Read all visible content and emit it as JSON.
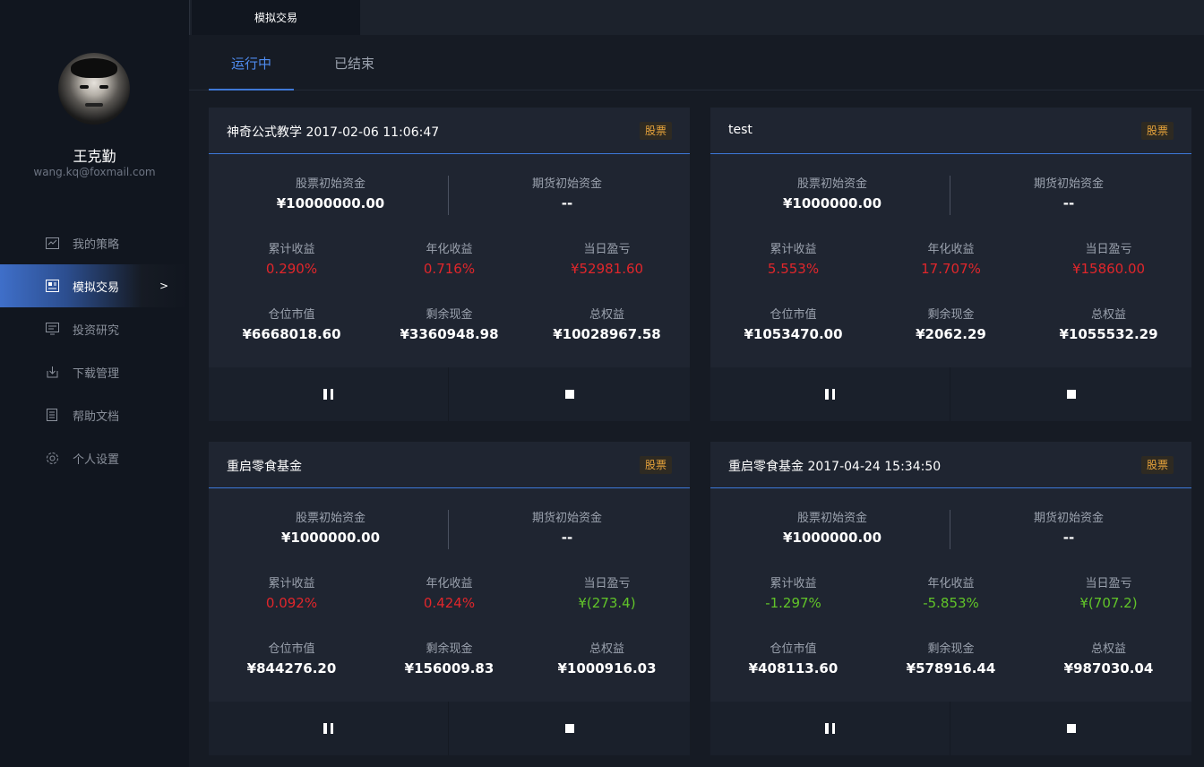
{
  "user": {
    "name": "王克勤",
    "email": "wang.kq@foxmail.com"
  },
  "sidebar": {
    "items": [
      {
        "label": "我的策略",
        "icon": "strategy-icon"
      },
      {
        "label": "模拟交易",
        "icon": "simulated-trading-icon",
        "active": true,
        "chevron": ">"
      },
      {
        "label": "投资研究",
        "icon": "research-icon"
      },
      {
        "label": "下载管理",
        "icon": "download-icon"
      },
      {
        "label": "帮助文档",
        "icon": "document-icon"
      },
      {
        "label": "个人设置",
        "icon": "gear-icon"
      }
    ]
  },
  "topbar": {
    "tab_label": "模拟交易"
  },
  "subtabs": {
    "running": "运行中",
    "ended": "已结束"
  },
  "labels": {
    "stock_initial": "股票初始资金",
    "futures_initial": "期货初始资金",
    "cumulative_return": "累计收益",
    "annualized_return": "年化收益",
    "daily_pnl": "当日盈亏",
    "position_value": "仓位市值",
    "remaining_cash": "剩余现金",
    "total_equity": "总权益"
  },
  "cards": [
    {
      "title": "神奇公式教学 2017-02-06 11:06:47",
      "badge": "股票",
      "stock_initial": "¥10000000.00",
      "futures_initial": "--",
      "cumulative_return": "0.290%",
      "annualized_return": "0.716%",
      "daily_pnl": "¥52981.60",
      "position_value": "¥6668018.60",
      "remaining_cash": "¥3360948.98",
      "total_equity": "¥10028967.58",
      "colors": {
        "cumulative_return": "#e0262b",
        "annualized_return": "#e0262b",
        "daily_pnl": "#e0262b"
      }
    },
    {
      "title": "test",
      "badge": "股票",
      "stock_initial": "¥1000000.00",
      "futures_initial": "--",
      "cumulative_return": "5.553%",
      "annualized_return": "17.707%",
      "daily_pnl": "¥15860.00",
      "position_value": "¥1053470.00",
      "remaining_cash": "¥2062.29",
      "total_equity": "¥1055532.29",
      "colors": {
        "cumulative_return": "#e0262b",
        "annualized_return": "#e0262b",
        "daily_pnl": "#e0262b"
      }
    },
    {
      "title": "重启零食基金",
      "badge": "股票",
      "stock_initial": "¥1000000.00",
      "futures_initial": "--",
      "cumulative_return": "0.092%",
      "annualized_return": "0.424%",
      "daily_pnl": "¥(273.4)",
      "position_value": "¥844276.20",
      "remaining_cash": "¥156009.83",
      "total_equity": "¥1000916.03",
      "colors": {
        "cumulative_return": "#e0262b",
        "annualized_return": "#e0262b",
        "daily_pnl": "#61c429"
      }
    },
    {
      "title": "重启零食基金 2017-04-24 15:34:50",
      "badge": "股票",
      "stock_initial": "¥1000000.00",
      "futures_initial": "--",
      "cumulative_return": "-1.297%",
      "annualized_return": "-5.853%",
      "daily_pnl": "¥(707.2)",
      "position_value": "¥408113.60",
      "remaining_cash": "¥578916.44",
      "total_equity": "¥987030.04",
      "colors": {
        "cumulative_return": "#61c429",
        "annualized_return": "#61c429",
        "daily_pnl": "#61c429"
      }
    }
  ]
}
